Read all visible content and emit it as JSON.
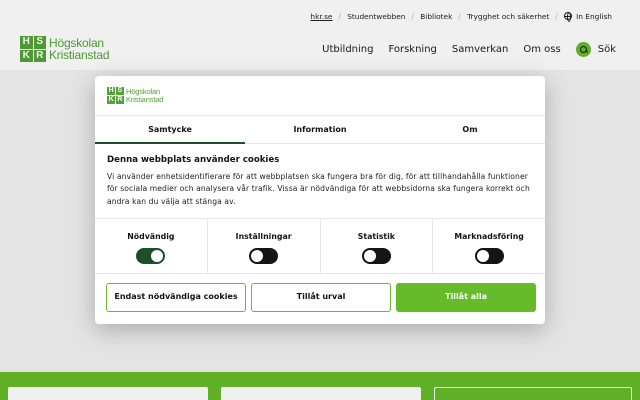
{
  "colors": {
    "brand_green": "#66bb2a",
    "dark_green": "#1f4f2a",
    "logo_green": "#53a337"
  },
  "logo": {
    "mark": [
      "H",
      "S",
      "K",
      "R"
    ],
    "line1": "Högskolan",
    "line2": "Kristianstad"
  },
  "top_links": [
    {
      "label": "hkr.se"
    },
    {
      "label": "Studentwebben"
    },
    {
      "label": "Bibliotek"
    },
    {
      "label": "Trygghet och säkerhet"
    },
    {
      "label": "In English",
      "icon": "globe-icon"
    }
  ],
  "main_nav": [
    {
      "label": "Utbildning"
    },
    {
      "label": "Forskning"
    },
    {
      "label": "Samverkan"
    },
    {
      "label": "Om oss"
    }
  ],
  "search": {
    "label": "Sök",
    "icon": "search-icon"
  },
  "cookie_dialog": {
    "tabs": [
      {
        "label": "Samtycke",
        "active": true
      },
      {
        "label": "Information",
        "active": false
      },
      {
        "label": "Om",
        "active": false
      }
    ],
    "heading": "Denna webbplats använder cookies",
    "body": "Vi använder enhetsidentifierare för att webbplatsen ska fungera bra för dig, för att tillhandahålla funktioner för sociala medier och analysera vår trafik. Vissa är nödvändiga för att webbsidorna ska fungera korrekt och andra kan du välja att stänga av.",
    "categories": [
      {
        "label": "Nödvändig",
        "enabled": true
      },
      {
        "label": "Inställningar",
        "enabled": false
      },
      {
        "label": "Statistik",
        "enabled": false
      },
      {
        "label": "Marknadsföring",
        "enabled": false
      }
    ],
    "buttons": {
      "necessary_only": "Endast nödvändiga cookies",
      "allow_selection": "Tillåt urval",
      "allow_all": "Tillåt alla"
    }
  }
}
